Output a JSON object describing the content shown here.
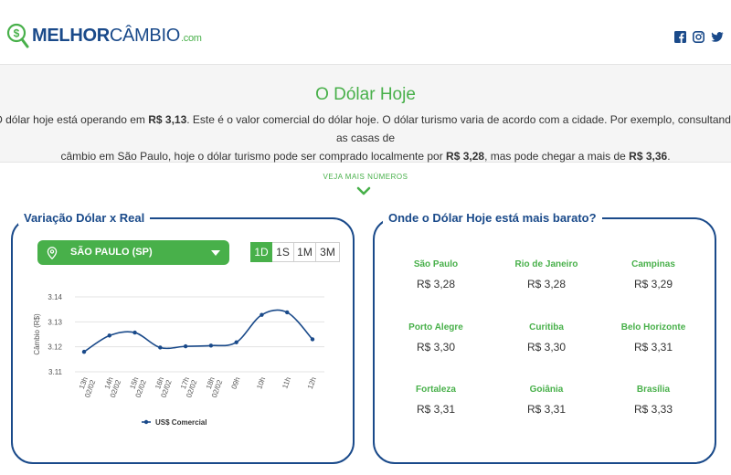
{
  "brand": {
    "name_bold": "MELHOR",
    "name_light": "CÂMBIO",
    "name_suffix": ".com",
    "green": "#48b04a",
    "blue": "#1a4a8a"
  },
  "social": [
    "facebook-icon",
    "instagram-icon",
    "twitter-icon"
  ],
  "hero": {
    "title": "O Dólar Hoje",
    "line1_a": "O dólar hoje está operando em ",
    "line1_b": "R$ 3,13",
    "line1_c": ". Este é o valor comercial do dólar hoje. O dólar turismo varia de acordo com a cidade. Por exemplo, consultando as casas de",
    "line2_a": "câmbio em São Paulo, hoje o dólar turismo pode ser comprado localmente por ",
    "line2_b": "R$ 3,28",
    "line2_c": ", mas pode chegar a mais de ",
    "line2_d": "R$ 3,36",
    "line2_e": "."
  },
  "more_label": "VEJA MAIS NÚMEROS",
  "left_panel": {
    "title": "Variação Dólar x Real",
    "city_selected": "SÃO PAULO (SP)",
    "ranges": [
      "1D",
      "1S",
      "1M",
      "3M"
    ],
    "active_range": "1D"
  },
  "chart_data": {
    "type": "line",
    "ylabel": "Câmbio (R$)",
    "xlabel": "",
    "ylim": [
      3.11,
      3.14
    ],
    "yticks": [
      "3.14",
      "3.13",
      "3.12",
      "3.11"
    ],
    "categories": [
      "13h 02/02",
      "14h 02/02",
      "15h 02/02",
      "16h 02/02",
      "17h 02/02",
      "18h 02/02",
      "09h",
      "10h",
      "11h",
      "12h"
    ],
    "series": [
      {
        "name": "US$ Comercial",
        "values": [
          3.118,
          3.1245,
          3.1257,
          3.1197,
          3.1202,
          3.1205,
          3.1218,
          3.1328,
          3.1338,
          3.123
        ]
      }
    ],
    "grid": true,
    "legend": "bottom",
    "line_color": "#1a4a8a"
  },
  "right_panel": {
    "title": "Onde o Dólar Hoje está mais barato?",
    "cities": [
      {
        "city": "São Paulo",
        "price": "R$ 3,28"
      },
      {
        "city": "Rio de Janeiro",
        "price": "R$ 3,28"
      },
      {
        "city": "Campinas",
        "price": "R$ 3,29"
      },
      {
        "city": "Porto Alegre",
        "price": "R$ 3,30"
      },
      {
        "city": "Curitiba",
        "price": "R$ 3,30"
      },
      {
        "city": "Belo Horizonte",
        "price": "R$ 3,31"
      },
      {
        "city": "Fortaleza",
        "price": "R$ 3,31"
      },
      {
        "city": "Goiânia",
        "price": "R$ 3,31"
      },
      {
        "city": "Brasília",
        "price": "R$ 3,33"
      }
    ]
  }
}
